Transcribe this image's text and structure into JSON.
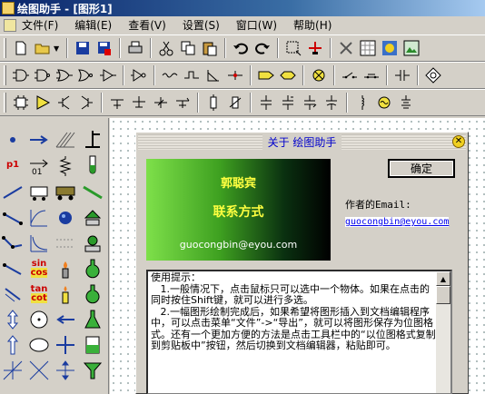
{
  "window": {
    "title": "绘图助手 - [图形1]"
  },
  "menu": [
    "文件(F)",
    "编辑(E)",
    "查看(V)",
    "设置(S)",
    "窗口(W)",
    "帮助(H)"
  ],
  "palette": {
    "p1_label": "p1",
    "sin_label": "sin",
    "cos_label": "cos",
    "tan_label": "tan",
    "cot_label": "cot"
  },
  "dialog": {
    "title": "关于 绘图助手",
    "banner_name": "郭聪宾",
    "banner_contact": "联系方式",
    "banner_email": "guocongbin@eyou.com",
    "ok_label": "确定",
    "author_label": "作者的Email:",
    "author_email": "guocongbin@eyou.com",
    "tips_text": "使用提示：\n   1.一般情况下，点击鼠标只可以选中一个物体。如果在点击的同时按住Shift键，就可以进行多选。\n   2.一幅图形绘制完成后，如果希望将图形插入到文档编辑程序中，可以点击菜单“文件”->“导出”，就可以将图形保存为位图格式。还有一个更加方便的方法是点击工具栏中的“以位图格式复制到剪贴板中”按钮，然后切换到文档编辑器，粘贴即可。"
  },
  "colors": {
    "title_start": "#0a246a",
    "banner_text": "#ffff40",
    "link": "#0000ee"
  }
}
